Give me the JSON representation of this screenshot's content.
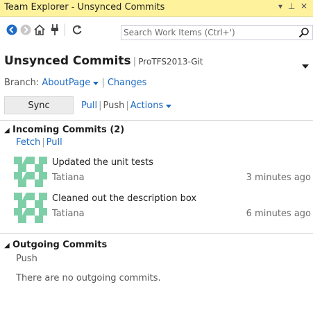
{
  "window": {
    "title": "Team Explorer - Unsynced Commits",
    "controls": {
      "dropdown": "▾",
      "pin": "⊥",
      "close": "✕"
    }
  },
  "toolbar": {
    "icons": [
      "back-icon",
      "forward-icon",
      "home-icon",
      "connect-icon",
      "refresh-icon"
    ],
    "search": {
      "placeholder": "Search Work Items (Ctrl+')"
    }
  },
  "page": {
    "title": "Unsynced Commits",
    "project": "ProTFS2013-Git"
  },
  "branch": {
    "label": "Branch:",
    "name": "AboutPage",
    "changes_link": "Changes"
  },
  "actions": {
    "sync": "Sync",
    "pull": "Pull",
    "push": "Push",
    "actions": "Actions"
  },
  "incoming": {
    "title": "Incoming Commits (2)",
    "fetch": "Fetch",
    "pull": "Pull",
    "commits": [
      {
        "message": "Updated the unit tests",
        "author": "Tatiana",
        "time": "3 minutes ago"
      },
      {
        "message": "Cleaned out the description box",
        "author": "Tatiana",
        "time": "6 minutes ago"
      }
    ]
  },
  "outgoing": {
    "title": "Outgoing Commits",
    "push": "Push",
    "empty": "There are no outgoing commits."
  },
  "colors": {
    "title_bar": "#fff29d",
    "link": "#1e6bc4",
    "avatar": "#7ecfa8"
  }
}
